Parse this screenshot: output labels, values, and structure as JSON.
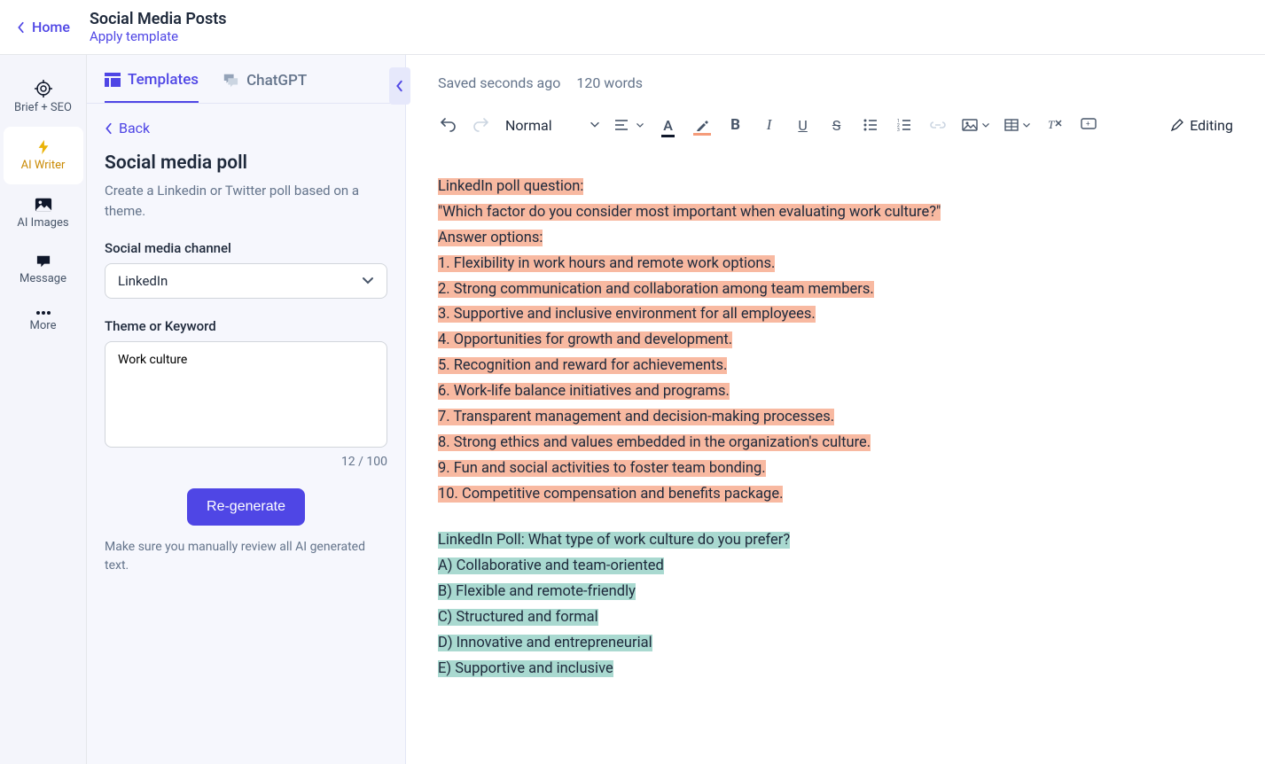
{
  "header": {
    "home": "Home",
    "title": "Social Media Posts",
    "apply_template": "Apply template"
  },
  "rail": {
    "items": [
      {
        "label": "Brief + SEO",
        "icon": "target"
      },
      {
        "label": "AI Writer",
        "icon": "bolt"
      },
      {
        "label": "AI Images",
        "icon": "image"
      },
      {
        "label": "Message",
        "icon": "chat"
      },
      {
        "label": "More",
        "icon": "dots"
      }
    ]
  },
  "panel": {
    "tabs": {
      "templates": "Templates",
      "chatgpt": "ChatGPT"
    },
    "back": "Back",
    "title": "Social media poll",
    "desc": "Create a Linkedin or Twitter poll based on a theme.",
    "channel_label": "Social media channel",
    "channel_value": "LinkedIn",
    "theme_label": "Theme or Keyword",
    "theme_value": "Work culture",
    "char_count": "12 / 100",
    "regenerate": "Re-generate",
    "note": "Make sure you manually review all AI generated text."
  },
  "editor": {
    "saved": "Saved seconds ago",
    "wordcount": "120 words",
    "format": "Normal",
    "editing": "Editing",
    "orange": [
      "LinkedIn poll question:",
      "\"Which factor do you consider most important when evaluating work culture?\"",
      "Answer options:",
      "1. Flexibility in work hours and remote work options.",
      "2. Strong communication and collaboration among team members.",
      "3. Supportive and inclusive environment for all employees.",
      "4. Opportunities for growth and development.",
      "5. Recognition and reward for achievements.",
      "6. Work-life balance initiatives and programs.",
      "7. Transparent management and decision-making processes.",
      "8. Strong ethics and values embedded in the organization's culture.",
      "9. Fun and social activities to foster team bonding.",
      "10. Competitive compensation and benefits package."
    ],
    "teal": [
      "LinkedIn Poll: What type of work culture do you prefer?",
      "A) Collaborative and team-oriented",
      "B) Flexible and remote-friendly",
      "C) Structured and formal",
      "D) Innovative and entrepreneurial",
      "E) Supportive and inclusive"
    ]
  }
}
